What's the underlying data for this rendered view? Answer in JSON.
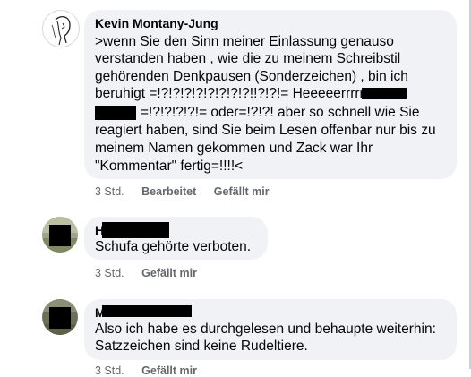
{
  "comments": [
    {
      "author": "Kevin Montany-Jung",
      "lines": [
        ">wenn Sie den Sinn meiner Einlassung genauso",
        "verstanden haben , wie die zu meinem Schreibstil",
        "gehörenden Denkpausen (Sonderzeichen) , bin ich",
        "beruhigt =!?!?!?!?!?!?!?!?!!?!?!= Heeeeerrrrr",
        "=!?!?!?!?!= oder=!?!?! aber so schnell wie Sie",
        "reagiert haben, sind Sie beim Lesen offenbar nur bis zu",
        "meinem Namen gekommen und Zack war Ihr",
        "\"Kommentar\" fertig=!!!!<"
      ],
      "time": "3 Std.",
      "edited": "Bearbeitet",
      "like": "Gefällt mir"
    },
    {
      "author_initial": "H",
      "text": "Schufa gehörte verboten.",
      "time": "3 Std.",
      "like": "Gefällt mir"
    },
    {
      "author_initial": "M",
      "lines": [
        "Also ich habe es durchgelesen und behaupte weiterhin:",
        "Satzzeichen sind keine Rudeltiere."
      ],
      "time": "3 Std.",
      "like": "Gefällt mir"
    }
  ],
  "colors": {
    "bubble": "#f0f2f5",
    "meta": "#65676b",
    "text": "#050505"
  }
}
